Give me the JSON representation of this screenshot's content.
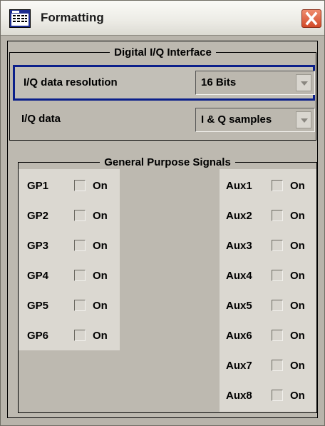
{
  "window": {
    "title": "Formatting",
    "icon": "formatting-app-icon"
  },
  "iq_interface": {
    "legend": "Digital I/Q Interface",
    "resolution": {
      "label": "I/Q data resolution",
      "value": "16 Bits"
    },
    "data": {
      "label": "I/Q data",
      "value": "I & Q samples"
    }
  },
  "gp_signals": {
    "legend": "General Purpose Signals",
    "on_label": "On",
    "gp": [
      "GP1",
      "GP2",
      "GP3",
      "GP4",
      "GP5",
      "GP6"
    ],
    "aux": [
      "Aux1",
      "Aux2",
      "Aux3",
      "Aux4",
      "Aux5",
      "Aux6",
      "Aux7",
      "Aux8"
    ]
  },
  "colors": {
    "focus_border": "#0b1f8a",
    "close_button": "#d24a2a"
  }
}
